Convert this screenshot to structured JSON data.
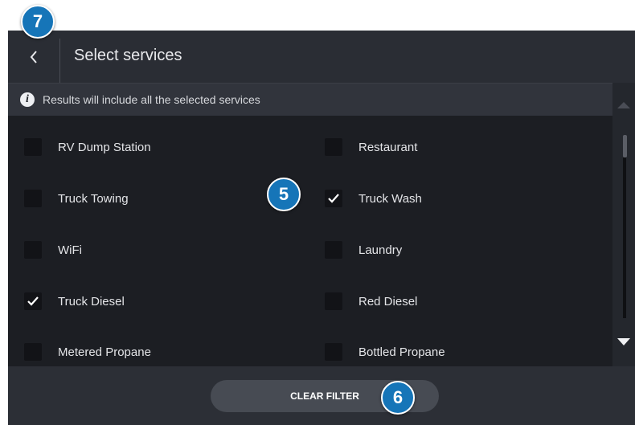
{
  "header": {
    "title": "Select services",
    "back_icon": "chevron-left-icon"
  },
  "info": {
    "text": "Results will include all the selected services",
    "icon": "info-icon"
  },
  "services": {
    "left": [
      {
        "label": "RV Dump Station",
        "checked": false
      },
      {
        "label": "Truck Towing",
        "checked": false
      },
      {
        "label": "WiFi",
        "checked": false
      },
      {
        "label": "Truck Diesel",
        "checked": true
      },
      {
        "label": "Metered Propane",
        "checked": false
      }
    ],
    "right": [
      {
        "label": "Restaurant",
        "checked": false
      },
      {
        "label": "Truck Wash",
        "checked": true
      },
      {
        "label": "Laundry",
        "checked": false
      },
      {
        "label": "Red Diesel",
        "checked": false
      },
      {
        "label": "Bottled Propane",
        "checked": false
      }
    ]
  },
  "footer": {
    "clear_label": "CLEAR FILTER"
  },
  "callouts": {
    "back": "7",
    "list": "5",
    "clear": "6"
  },
  "colors": {
    "background": "#1c1e23",
    "header": "#2a2d34",
    "callout": "#1675b8"
  }
}
